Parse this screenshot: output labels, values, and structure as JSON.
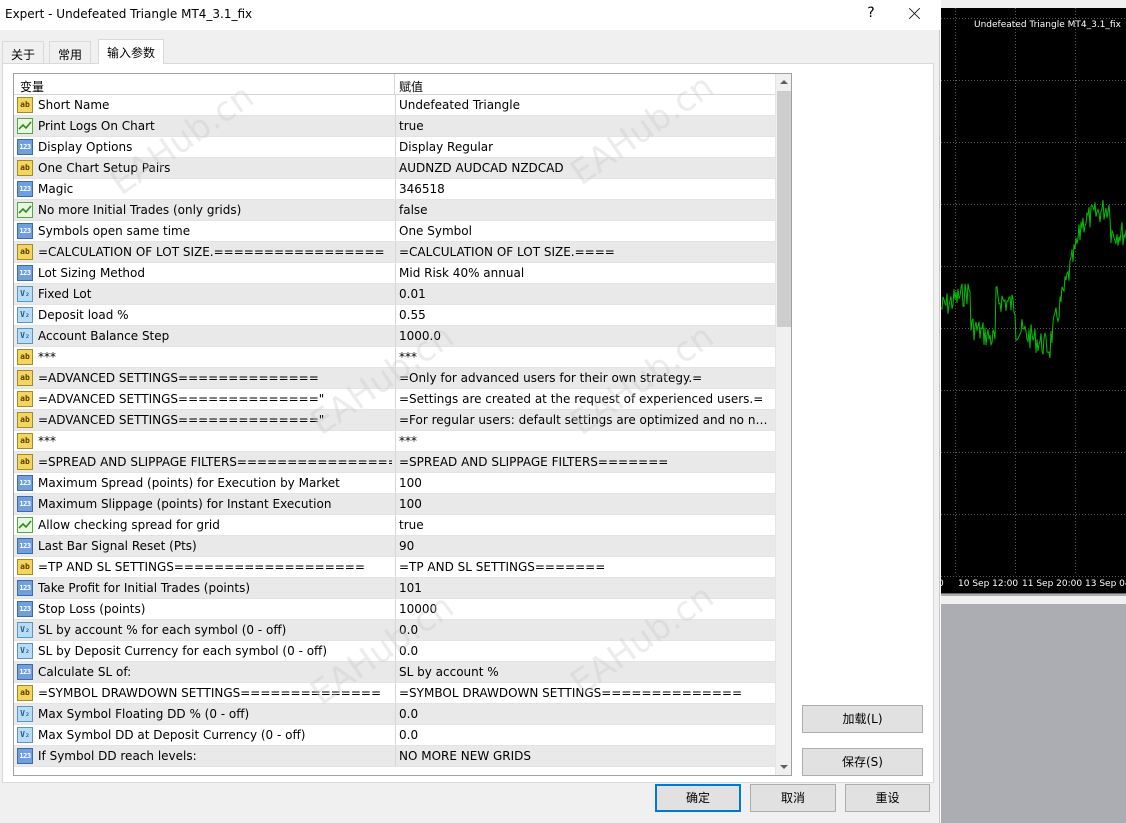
{
  "window": {
    "title": "Expert - Undefeated Triangle MT4_3.1_fix",
    "help": "?"
  },
  "tabs": [
    {
      "label": "关于"
    },
    {
      "label": "常用"
    },
    {
      "label": "输入参数"
    }
  ],
  "grid": {
    "col_variable": "变量",
    "col_value": "赋值",
    "rows": [
      {
        "type": "ab",
        "name": "Short Name",
        "value": "Undefeated Triangle"
      },
      {
        "type": "bool",
        "name": "Print Logs On Chart",
        "value": "true"
      },
      {
        "type": "123",
        "name": "Display Options",
        "value": "Display Regular"
      },
      {
        "type": "ab",
        "name": "One Chart Setup Pairs",
        "value": "AUDNZD AUDCAD NZDCAD"
      },
      {
        "type": "123",
        "name": "Magic",
        "value": "346518"
      },
      {
        "type": "bool",
        "name": "No more Initial Trades (only grids)",
        "value": "false"
      },
      {
        "type": "123",
        "name": "Symbols open same time",
        "value": "One Symbol"
      },
      {
        "type": "ab",
        "name": "=CALCULATION OF LOT SIZE.=================",
        "value": "=CALCULATION OF LOT SIZE.===="
      },
      {
        "type": "123",
        "name": "Lot Sizing Method",
        "value": "Mid Risk 40% annual"
      },
      {
        "type": "v2",
        "name": "Fixed Lot",
        "value": "0.01"
      },
      {
        "type": "v2",
        "name": "Deposit load %",
        "value": "0.55"
      },
      {
        "type": "v2",
        "name": "Account Balance Step",
        "value": "1000.0"
      },
      {
        "type": "ab",
        "name": "***",
        "value": "***"
      },
      {
        "type": "ab",
        "name": "=ADVANCED SETTINGS==============",
        "value": "=Only for advanced users for their own strategy.="
      },
      {
        "type": "ab",
        "name": "=ADVANCED SETTINGS==============\"",
        "value": "=Settings are created at the request of experienced users.="
      },
      {
        "type": "ab",
        "name": "=ADVANCED SETTINGS==============\"",
        "value": "=For regular users: default settings are optimized and no nee..."
      },
      {
        "type": "ab",
        "name": "***",
        "value": "***"
      },
      {
        "type": "ab",
        "name": "=SPREAD AND SLIPPAGE FILTERS=================...",
        "value": "=SPREAD AND SLIPPAGE FILTERS======="
      },
      {
        "type": "123",
        "name": "Maximum Spread (points) for Execution by Market",
        "value": "100"
      },
      {
        "type": "123",
        "name": "Maximum Slippage (points) for Instant Execution",
        "value": "100"
      },
      {
        "type": "bool",
        "name": "Allow checking spread for grid",
        "value": "true"
      },
      {
        "type": "123",
        "name": "Last Bar Signal Reset (Pts)",
        "value": "90"
      },
      {
        "type": "ab",
        "name": "=TP AND SL SETTINGS===================",
        "value": "=TP AND SL SETTINGS======="
      },
      {
        "type": "123",
        "name": "Take Profit for Initial Trades (points)",
        "value": "101"
      },
      {
        "type": "123",
        "name": "Stop Loss (points)",
        "value": "10000"
      },
      {
        "type": "v2",
        "name": "SL by account % for each symbol (0 - off)",
        "value": "0.0"
      },
      {
        "type": "v2",
        "name": "SL by Deposit Currency for each symbol (0 - off)",
        "value": "0.0"
      },
      {
        "type": "123",
        "name": "Calculate SL of:",
        "value": "SL by account %"
      },
      {
        "type": "ab",
        "name": "=SYMBOL DRAWDOWN SETTINGS==============",
        "value": "=SYMBOL DRAWDOWN SETTINGS=============="
      },
      {
        "type": "v2",
        "name": "Max Symbol Floating DD % (0 - off)",
        "value": "0.0"
      },
      {
        "type": "v2",
        "name": "Max Symbol DD at Deposit Currency (0 - off)",
        "value": "0.0"
      },
      {
        "type": "123",
        "name": "If Symbol DD reach levels:",
        "value": "NO MORE NEW GRIDS"
      }
    ]
  },
  "buttons": {
    "load": "加载(L)",
    "save": "保存(S)",
    "ok": "确定",
    "cancel": "取消",
    "reset": "重设"
  },
  "chart": {
    "title": "Undefeated Triangle MT4_3.1_fix",
    "time_labels": [
      "10 Sep 12:00",
      "11 Sep 20:00",
      "13 Sep 04"
    ],
    "left_edge_label": "0",
    "line_color": "#00c000",
    "background": "#000000"
  },
  "watermark": "EAHub.cn"
}
